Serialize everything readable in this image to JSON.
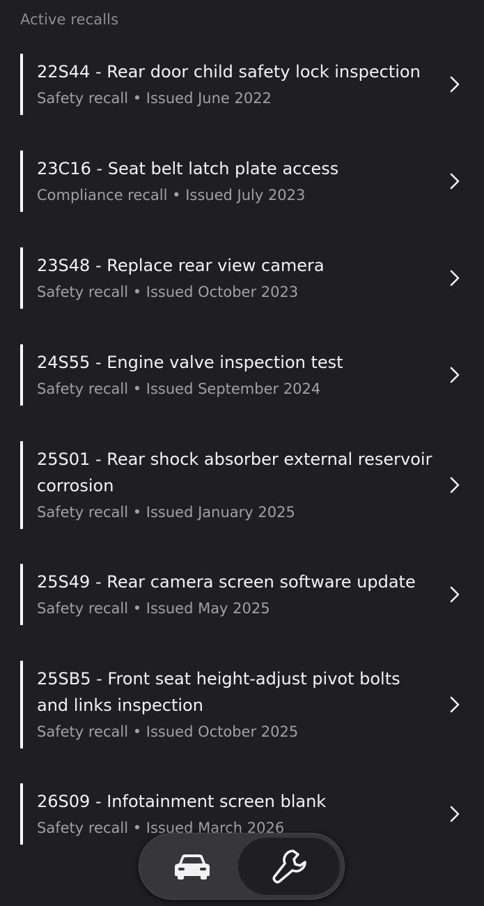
{
  "section": {
    "title": "Active recalls"
  },
  "recalls": [
    {
      "title": "22S44 - Rear door child safety lock inspection",
      "meta": "Safety recall • Issued June 2022"
    },
    {
      "title": "23C16 - Seat belt latch plate access",
      "meta": "Compliance recall • Issued July 2023"
    },
    {
      "title": "23S48 - Replace rear view camera",
      "meta": "Safety recall • Issued October 2023"
    },
    {
      "title": "24S55 - Engine valve inspection test",
      "meta": "Safety recall • Issued September 2024"
    },
    {
      "title": "25S01 - Rear shock absorber external reservoir corrosion",
      "meta": "Safety recall • Issued January 2025"
    },
    {
      "title": "25S49 - Rear camera screen software update",
      "meta": "Safety recall • Issued May 2025"
    },
    {
      "title": "25SB5 - Front seat height-adjust pivot bolts and links inspection",
      "meta": "Safety recall • Issued October 2025"
    },
    {
      "title": "26S09 - Infotainment screen blank",
      "meta": "Safety recall • Issued March 2026"
    }
  ],
  "bottom_nav": {
    "tabs": [
      {
        "icon": "car-icon",
        "active": false
      },
      {
        "icon": "wrench-icon",
        "active": true
      }
    ]
  },
  "colors": {
    "background": "#1f1f21",
    "accent_bar": "#ffffff",
    "primary_text": "#f3f3f3",
    "secondary_text": "#a1a1a5"
  }
}
